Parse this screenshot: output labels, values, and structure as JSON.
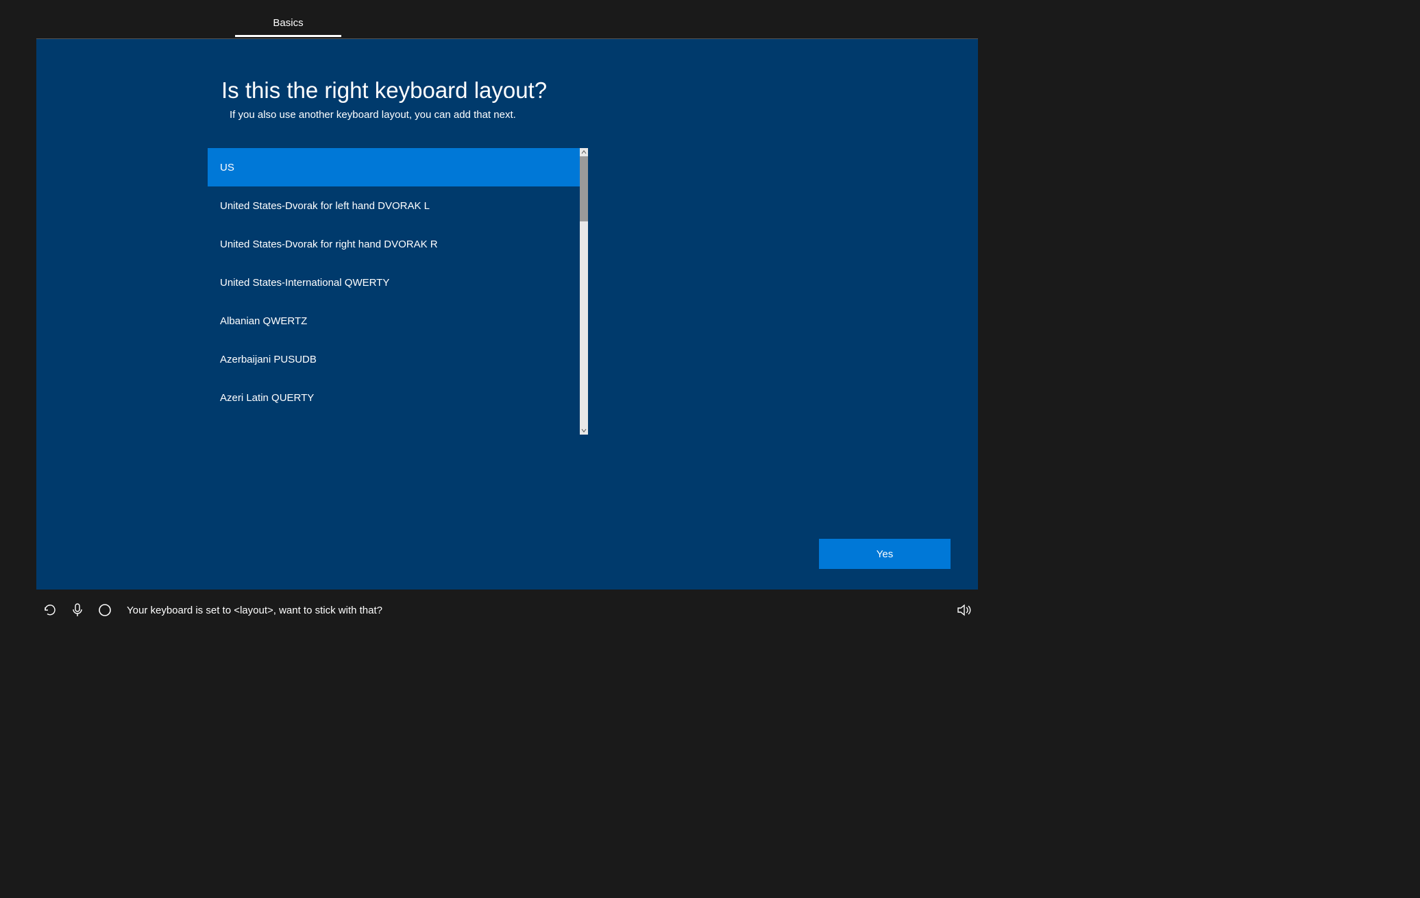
{
  "header": {
    "tab_label": "Basics"
  },
  "main": {
    "heading": "Is this the right keyboard layout?",
    "subtext": "If you also use another keyboard layout, you can add that next.",
    "layouts": [
      "US",
      "United States-Dvorak for left hand DVORAK L",
      "United States-Dvorak for right hand DVORAK R",
      "United States-International QWERTY",
      "Albanian QWERTZ",
      "Azerbaijani PUSUDB",
      "Azeri Latin QUERTY"
    ],
    "selected_index": 0,
    "confirm_label": "Yes"
  },
  "footer": {
    "cortana_text": "Your keyboard is set to <layout>, want to stick with that?"
  }
}
